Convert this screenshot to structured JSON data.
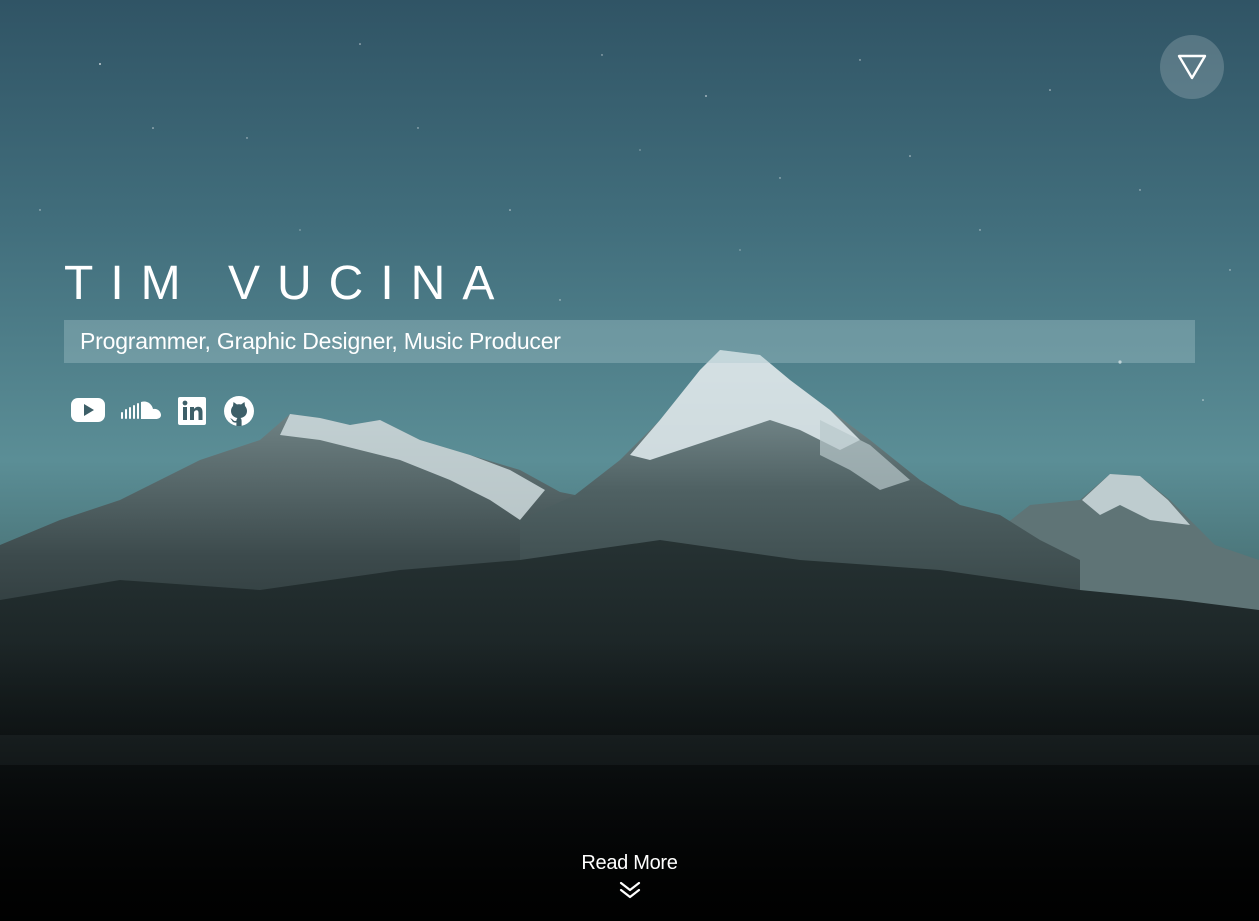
{
  "hero": {
    "name": "TIM VUCINA",
    "tagline": "Programmer, Graphic Designer, Music Producer",
    "read_more_label": "Read More"
  },
  "menu": {
    "icon": "triangle-down-icon"
  },
  "social": [
    {
      "name": "YouTube",
      "icon": "youtube-icon"
    },
    {
      "name": "SoundCloud",
      "icon": "soundcloud-icon"
    },
    {
      "name": "LinkedIn",
      "icon": "linkedin-icon"
    },
    {
      "name": "GitHub",
      "icon": "github-icon"
    }
  ],
  "colors": {
    "sky_top": "#2f5466",
    "sky_mid": "#4d8591",
    "mountain_dark": "#1c2727",
    "snow": "#d9e6e9",
    "text": "#ffffff"
  }
}
